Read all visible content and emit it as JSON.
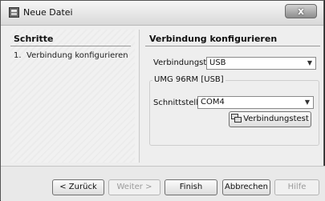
{
  "window": {
    "title": "Neue Datei",
    "close_label": "x"
  },
  "left": {
    "title": "Schritte",
    "steps": [
      {
        "num": "1.",
        "label": "Verbindung konfigurieren"
      }
    ]
  },
  "right": {
    "title": "Verbindung konfigurieren",
    "connection_type_label": "Verbindungstyp",
    "connection_type_value": "USB",
    "group_title": "UMG 96RM [USB]",
    "interface_label": "Schnittstelle",
    "interface_value": "COM4",
    "test_button_label": "Verbindungstest"
  },
  "buttons": {
    "back": "< Zurück",
    "next": "Weiter >",
    "finish": "Finish",
    "cancel": "Abbrechen",
    "help": "Hilfe"
  },
  "icons": {
    "app": "application-icon",
    "close": "close-icon",
    "dropdown": "chevron-down-icon",
    "test": "network-test-icon"
  }
}
